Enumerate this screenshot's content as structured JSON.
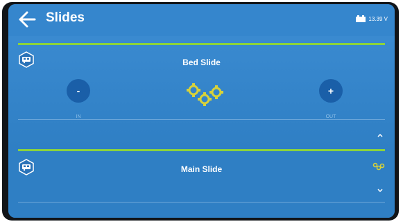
{
  "header": {
    "title": "Slides",
    "back_icon": "back-arrow-icon",
    "battery_icon": "battery-icon",
    "battery_voltage": "13.39 V"
  },
  "slides": [
    {
      "name": "Bed Slide",
      "icon": "camper-icon",
      "status_icon": "gears-icon",
      "in_button": "-",
      "out_button": "+",
      "in_label": "IN",
      "out_label": "OUT",
      "expanded": true,
      "chevron_icon": "chevron-up-icon"
    },
    {
      "name": "Main Slide",
      "icon": "camper-icon",
      "status_icon": "gears-small-icon",
      "expanded": false,
      "chevron_icon": "chevron-down-icon"
    }
  ],
  "colors": {
    "accent_green": "#8bd33d",
    "gear_yellow": "#d7d23a",
    "background_blue": "#2f7fc4",
    "button_blue": "#1a5fa8"
  }
}
